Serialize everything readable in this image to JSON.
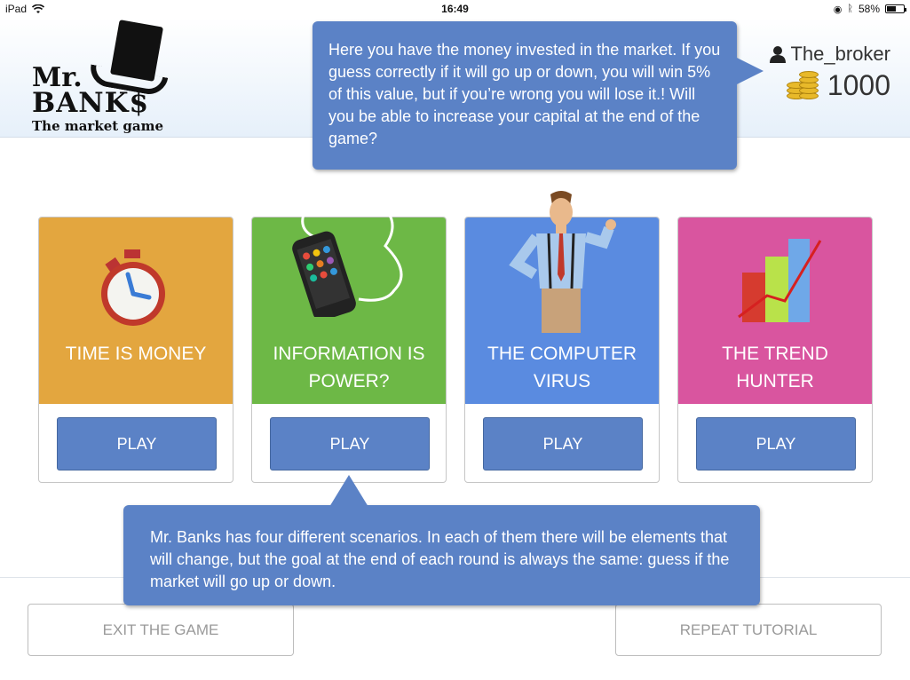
{
  "status_bar": {
    "device": "iPad",
    "time": "16:49",
    "battery": "58%",
    "battery_level": 0.58
  },
  "header": {
    "logo": {
      "line1": "Mr.",
      "line2": "BANK$",
      "tagline": "The market game"
    },
    "username": "The_broker",
    "coins": "1000",
    "icons": {
      "user": "user-icon",
      "coins": "coins-icon"
    }
  },
  "tooltips": {
    "top": "Here you have the money invested in the market. If you guess correctly if it will go up or down, you will win 5% of this value, but if you’re wrong you will lose it.! Will you be able to increase your capital at the end of the game?",
    "bottom": "Mr. Banks has four different scenarios. In each of them there will be elements that will change, but the goal at the end of each round is always the same: guess if the market will go up or down."
  },
  "scenarios": [
    {
      "title": "TIME IS MONEY",
      "play_label": "PLAY",
      "color": "#e3a63f",
      "icon": "stopwatch-icon"
    },
    {
      "title": "INFORMATION IS\nPOWER?",
      "play_label": "PLAY",
      "color": "#6db846",
      "icon": "smartphone-icon"
    },
    {
      "title": "THE COMPUTER\nVIRUS",
      "play_label": "PLAY",
      "color": "#5a8be0",
      "icon": "businessman-icon"
    },
    {
      "title": "THE TREND\nHUNTER",
      "play_label": "PLAY",
      "color": "#d9559f",
      "icon": "bar-chart-icon"
    }
  ],
  "footer": {
    "exit_label": "EXIT THE GAME",
    "repeat_label": "REPEAT TUTORIAL"
  }
}
